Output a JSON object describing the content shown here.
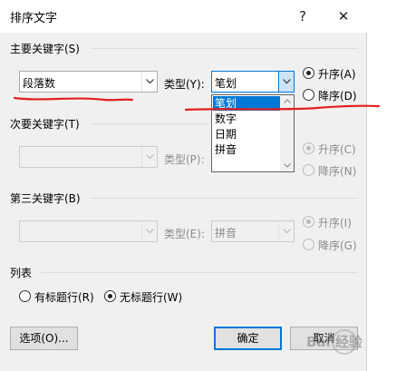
{
  "dialog": {
    "title": "排序文字",
    "help_glyph": "?",
    "close_glyph": "✕"
  },
  "primary": {
    "section_label": "主要关键字(S)",
    "key_value": "段落数",
    "type_label": "类型(Y):",
    "type_value": "笔划",
    "asc_label": "升序(A)",
    "desc_label": "降序(D)",
    "order": "asc"
  },
  "type_dropdown": {
    "options": [
      "笔划",
      "数字",
      "日期",
      "拼音"
    ],
    "selected": "笔划"
  },
  "secondary": {
    "section_label": "次要关键字(T)",
    "key_value": "",
    "type_label": "类型(P):",
    "type_value": "",
    "asc_label": "升序(C)",
    "desc_label": "降序(N)"
  },
  "tertiary": {
    "section_label": "第三关键字(B)",
    "key_value": "",
    "type_label": "类型(E):",
    "type_value": "拼音",
    "asc_label": "升序(I)",
    "desc_label": "降序(G)"
  },
  "list": {
    "section_label": "列表",
    "has_header_label": "有标题行(R)",
    "no_header_label": "无标题行(W)",
    "selected": "no_header"
  },
  "buttons": {
    "options_label": "选项(O)...",
    "ok_label": "确定",
    "cancel_label": "取消"
  },
  "watermark_text": "Bai 经验",
  "colors": {
    "annotation_red": "#e02020",
    "accent": "#0078d7"
  }
}
